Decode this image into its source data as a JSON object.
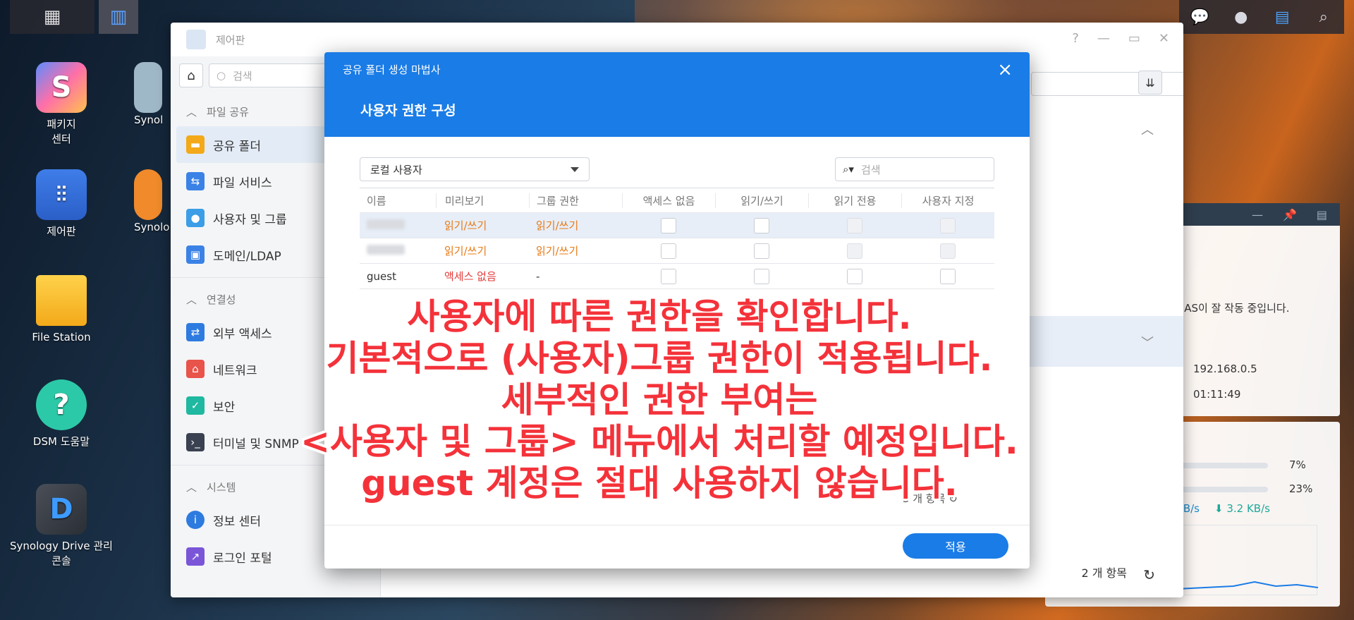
{
  "desktop": {
    "icons": [
      {
        "label": "패키지\n센터"
      },
      {
        "label": "Synol"
      },
      {
        "label": "제어판"
      },
      {
        "label": "Synolo"
      },
      {
        "label": "File Station"
      },
      {
        "label": "DSM 도움말"
      },
      {
        "label": "Synology Drive 관리\n콘솔"
      }
    ]
  },
  "control_panel": {
    "title": "제어판",
    "search_placeholder": "검색",
    "sections": {
      "file_sharing": "파일 공유",
      "connectivity": "연결성",
      "system": "시스템"
    },
    "items": {
      "shared_folder": "공유 폴더",
      "file_services": "파일 서비스",
      "users_groups": "사용자 및 그룹",
      "domain_ldap": "도메인/LDAP",
      "external_access": "외부 액세스",
      "network": "네트워크",
      "security": "보안",
      "terminal_snmp": "터미널 및 SNMP",
      "info_center": "정보 센터",
      "login_portal": "로그인 포털"
    },
    "footer_count": "2 개 항목"
  },
  "widgets": {
    "status_text": "NAS이 잘 작동 중입니다.",
    "ip": "192.168.0.5",
    "uptime": "01:11:49",
    "cpu": "7%",
    "ram": "23%",
    "upload": "KB/s",
    "download": "3.2 KB/s"
  },
  "modal": {
    "wizard_title": "공유 폴더 생성 마법사",
    "heading": "사용자 권한 구성",
    "user_type": "로컬 사용자",
    "search_placeholder": "검색",
    "headers": {
      "name": "이름",
      "preview": "미리보기",
      "group_perm": "그룹 권한",
      "no_access": "액세스 없음",
      "read_write": "읽기/쓰기",
      "read_only": "읽기 전용",
      "custom": "사용자 지정"
    },
    "rows": [
      {
        "name": "",
        "preview": "읽기/쓰기",
        "group": "읽기/쓰기"
      },
      {
        "name": "",
        "preview": "읽기/쓰기",
        "group": "읽기/쓰기"
      },
      {
        "name": "guest",
        "preview": "액세스 없음",
        "group": "-"
      }
    ],
    "item_count": "3 개 항목",
    "apply_label": "적용"
  },
  "annotation": {
    "lines": [
      "사용자에 따른 권한을 확인합니다.",
      "기본적으로 (사용자)그룹 권한이 적용됩니다.",
      "세부적인 권한 부여는",
      "<사용자 및 그룹> 메뉴에서 처리할 예정입니다.",
      "guest 계정은 절대 사용하지 않습니다."
    ]
  },
  "colors": {
    "accent": "#1a7ce6",
    "annotation": "#f4323a",
    "orange": "#e87a16",
    "red": "#e33b3b"
  }
}
